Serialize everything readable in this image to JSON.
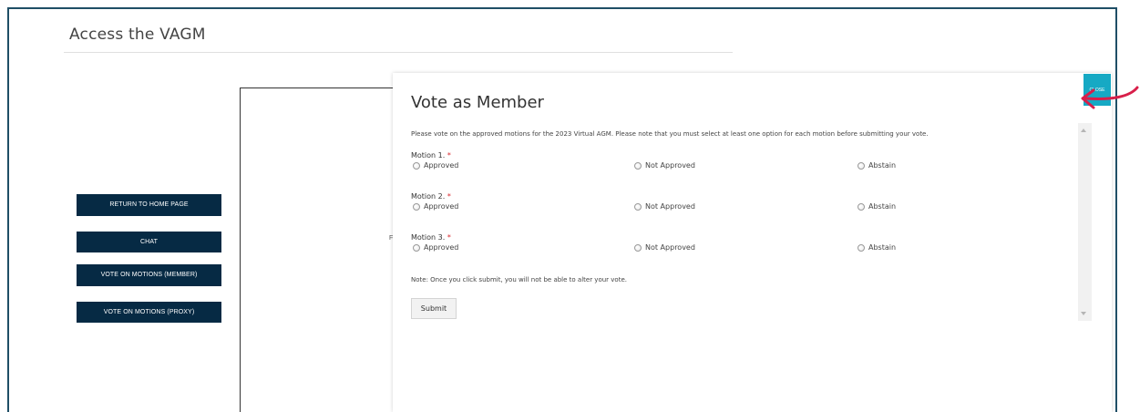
{
  "page": {
    "title": "Access the VAGM"
  },
  "sidebar": {
    "buttons": [
      {
        "label": "RETURN TO HOME PAGE"
      },
      {
        "label": "CHAT"
      },
      {
        "label": "VOTE ON MOTIONS (MEMBER)"
      },
      {
        "label": "VOTE ON MOTIONS (PROXY)"
      }
    ]
  },
  "background": {
    "stray_text": "F"
  },
  "modal": {
    "title": "Vote as Member",
    "intro": "Please vote on the approved motions for the 2023 Virtual AGM. Please note that you must select at least one option for each motion before submitting your vote.",
    "required_marker": "*",
    "motions": [
      {
        "label": "Motion 1.",
        "options": [
          "Approved",
          "Not Approved",
          "Abstain"
        ]
      },
      {
        "label": "Motion 2.",
        "options": [
          "Approved",
          "Not Approved",
          "Abstain"
        ]
      },
      {
        "label": "Motion 3.",
        "options": [
          "Approved",
          "Not Approved",
          "Abstain"
        ]
      }
    ],
    "note": "Note: Once you click submit, you will not be able to alter your vote.",
    "submit_label": "Submit",
    "close_label": "CLOSE"
  },
  "colors": {
    "nav_button": "#062a44",
    "close_button": "#16a9c4",
    "annotation_arrow": "#d81f4a",
    "required": "#d9262c"
  },
  "icons": {
    "annotation": "curved-arrow-icon",
    "radio": "radio-icon"
  }
}
